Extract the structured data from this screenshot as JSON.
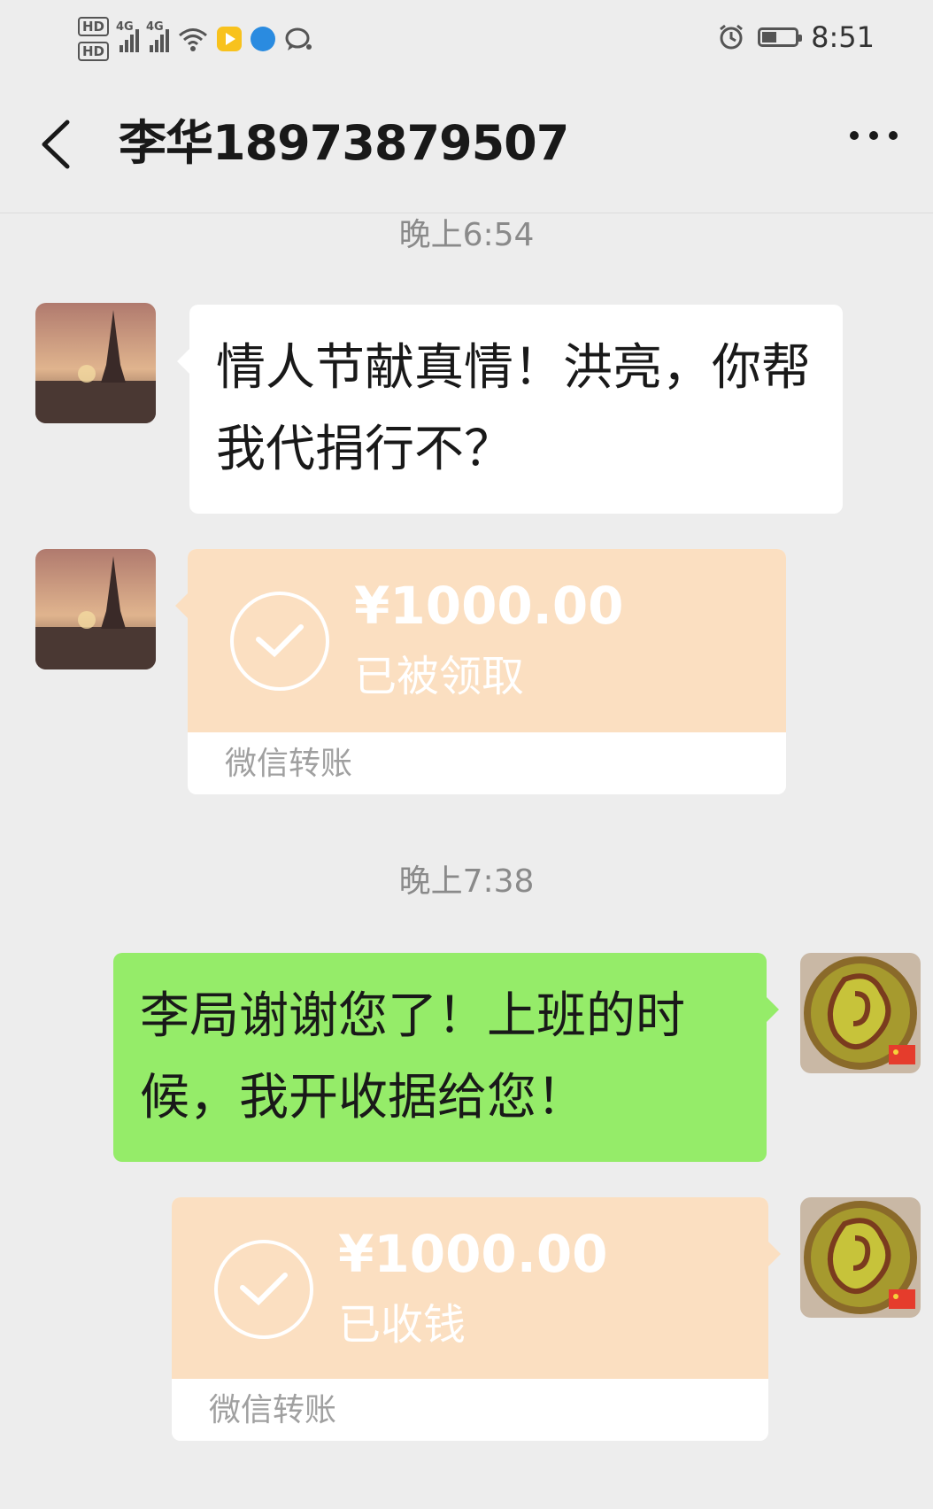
{
  "status_bar": {
    "hd1": "HD",
    "hd2": "HD",
    "signal1_label": "4G",
    "signal2_label": "4G",
    "time": "8:51",
    "icons": [
      "hd-icon",
      "signal-icon",
      "wifi-icon",
      "video-app-icon",
      "browser-app-icon",
      "chat-notification-icon",
      "alarm-icon",
      "battery-icon"
    ]
  },
  "header": {
    "title": "李华18973879507",
    "back_icon": "chevron-left-icon",
    "more_icon": "more-dots-icon"
  },
  "messages": {
    "time1": "晚上6:54",
    "msg1": "情人节献真情！洪亮，你帮我代捐行不？",
    "transfer1": {
      "amount": "¥1000.00",
      "status": "已被领取",
      "footer": "微信转账"
    },
    "time2": "晚上7:38",
    "msg2": "李局谢谢您了！上班的时候，我开收据给您！",
    "transfer2": {
      "amount": "¥1000.00",
      "status": "已收钱",
      "footer": "微信转账"
    }
  },
  "colors": {
    "background": "#ededed",
    "incoming_bubble": "#ffffff",
    "outgoing_bubble": "#95ec69",
    "transfer_card": "#fbdfc1"
  }
}
